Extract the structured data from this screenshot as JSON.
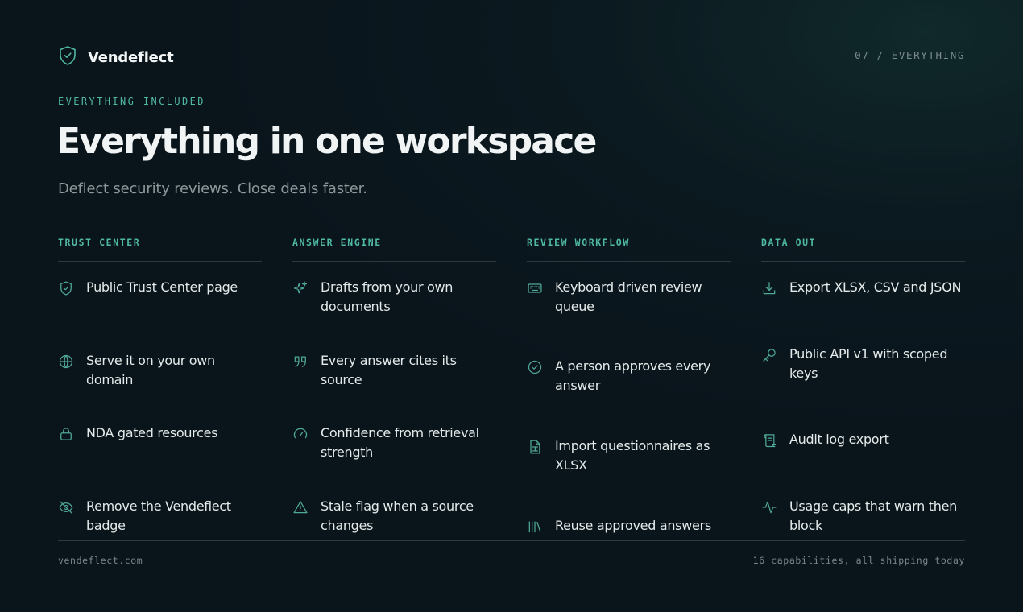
{
  "brand": {
    "name": "Vendeflect",
    "logo_icon": "shield-check-icon"
  },
  "page_indicator": "07 / EVERYTHING",
  "eyebrow": "EVERYTHING INCLUDED",
  "title": "Everything in one workspace",
  "subtitle": "Deflect security reviews. Close deals faster.",
  "columns": [
    {
      "heading": "TRUST CENTER",
      "items": [
        {
          "label": "Public Trust Center page",
          "icon": "shield-check-icon"
        },
        {
          "label": "Serve it on your own domain",
          "icon": "globe-icon"
        },
        {
          "label": "NDA gated resources",
          "icon": "lock-icon"
        },
        {
          "label": "Remove the Vendeflect badge",
          "icon": "eye-off-icon"
        }
      ]
    },
    {
      "heading": "ANSWER ENGINE",
      "items": [
        {
          "label": "Drafts from your own documents",
          "icon": "sparkles-icon"
        },
        {
          "label": "Every answer cites its source",
          "icon": "quote-icon"
        },
        {
          "label": "Confidence from retrieval strength",
          "icon": "gauge-icon"
        },
        {
          "label": "Stale flag when a source changes",
          "icon": "warning-triangle-icon"
        }
      ]
    },
    {
      "heading": "REVIEW WORKFLOW",
      "items": [
        {
          "label": "Keyboard driven review queue",
          "icon": "keyboard-icon"
        },
        {
          "label": "A person approves every answer",
          "icon": "check-circle-icon"
        },
        {
          "label": "Import questionnaires as XLSX",
          "icon": "spreadsheet-file-icon"
        },
        {
          "label": "Reuse approved answers",
          "icon": "library-icon"
        }
      ]
    },
    {
      "heading": "DATA OUT",
      "items": [
        {
          "label": "Export XLSX, CSV and JSON",
          "icon": "download-icon"
        },
        {
          "label": "Public API v1 with scoped keys",
          "icon": "key-icon"
        },
        {
          "label": "Audit log export",
          "icon": "scroll-icon"
        },
        {
          "label": "Usage caps that warn then block",
          "icon": "activity-icon"
        }
      ]
    }
  ],
  "footer": {
    "domain": "vendeflect.com",
    "capabilities": "16 capabilities, all shipping today"
  },
  "colors": {
    "accent": "#4fb9a3",
    "background": "#0a141b",
    "text": "#e4eaea",
    "muted": "#8b9799"
  }
}
